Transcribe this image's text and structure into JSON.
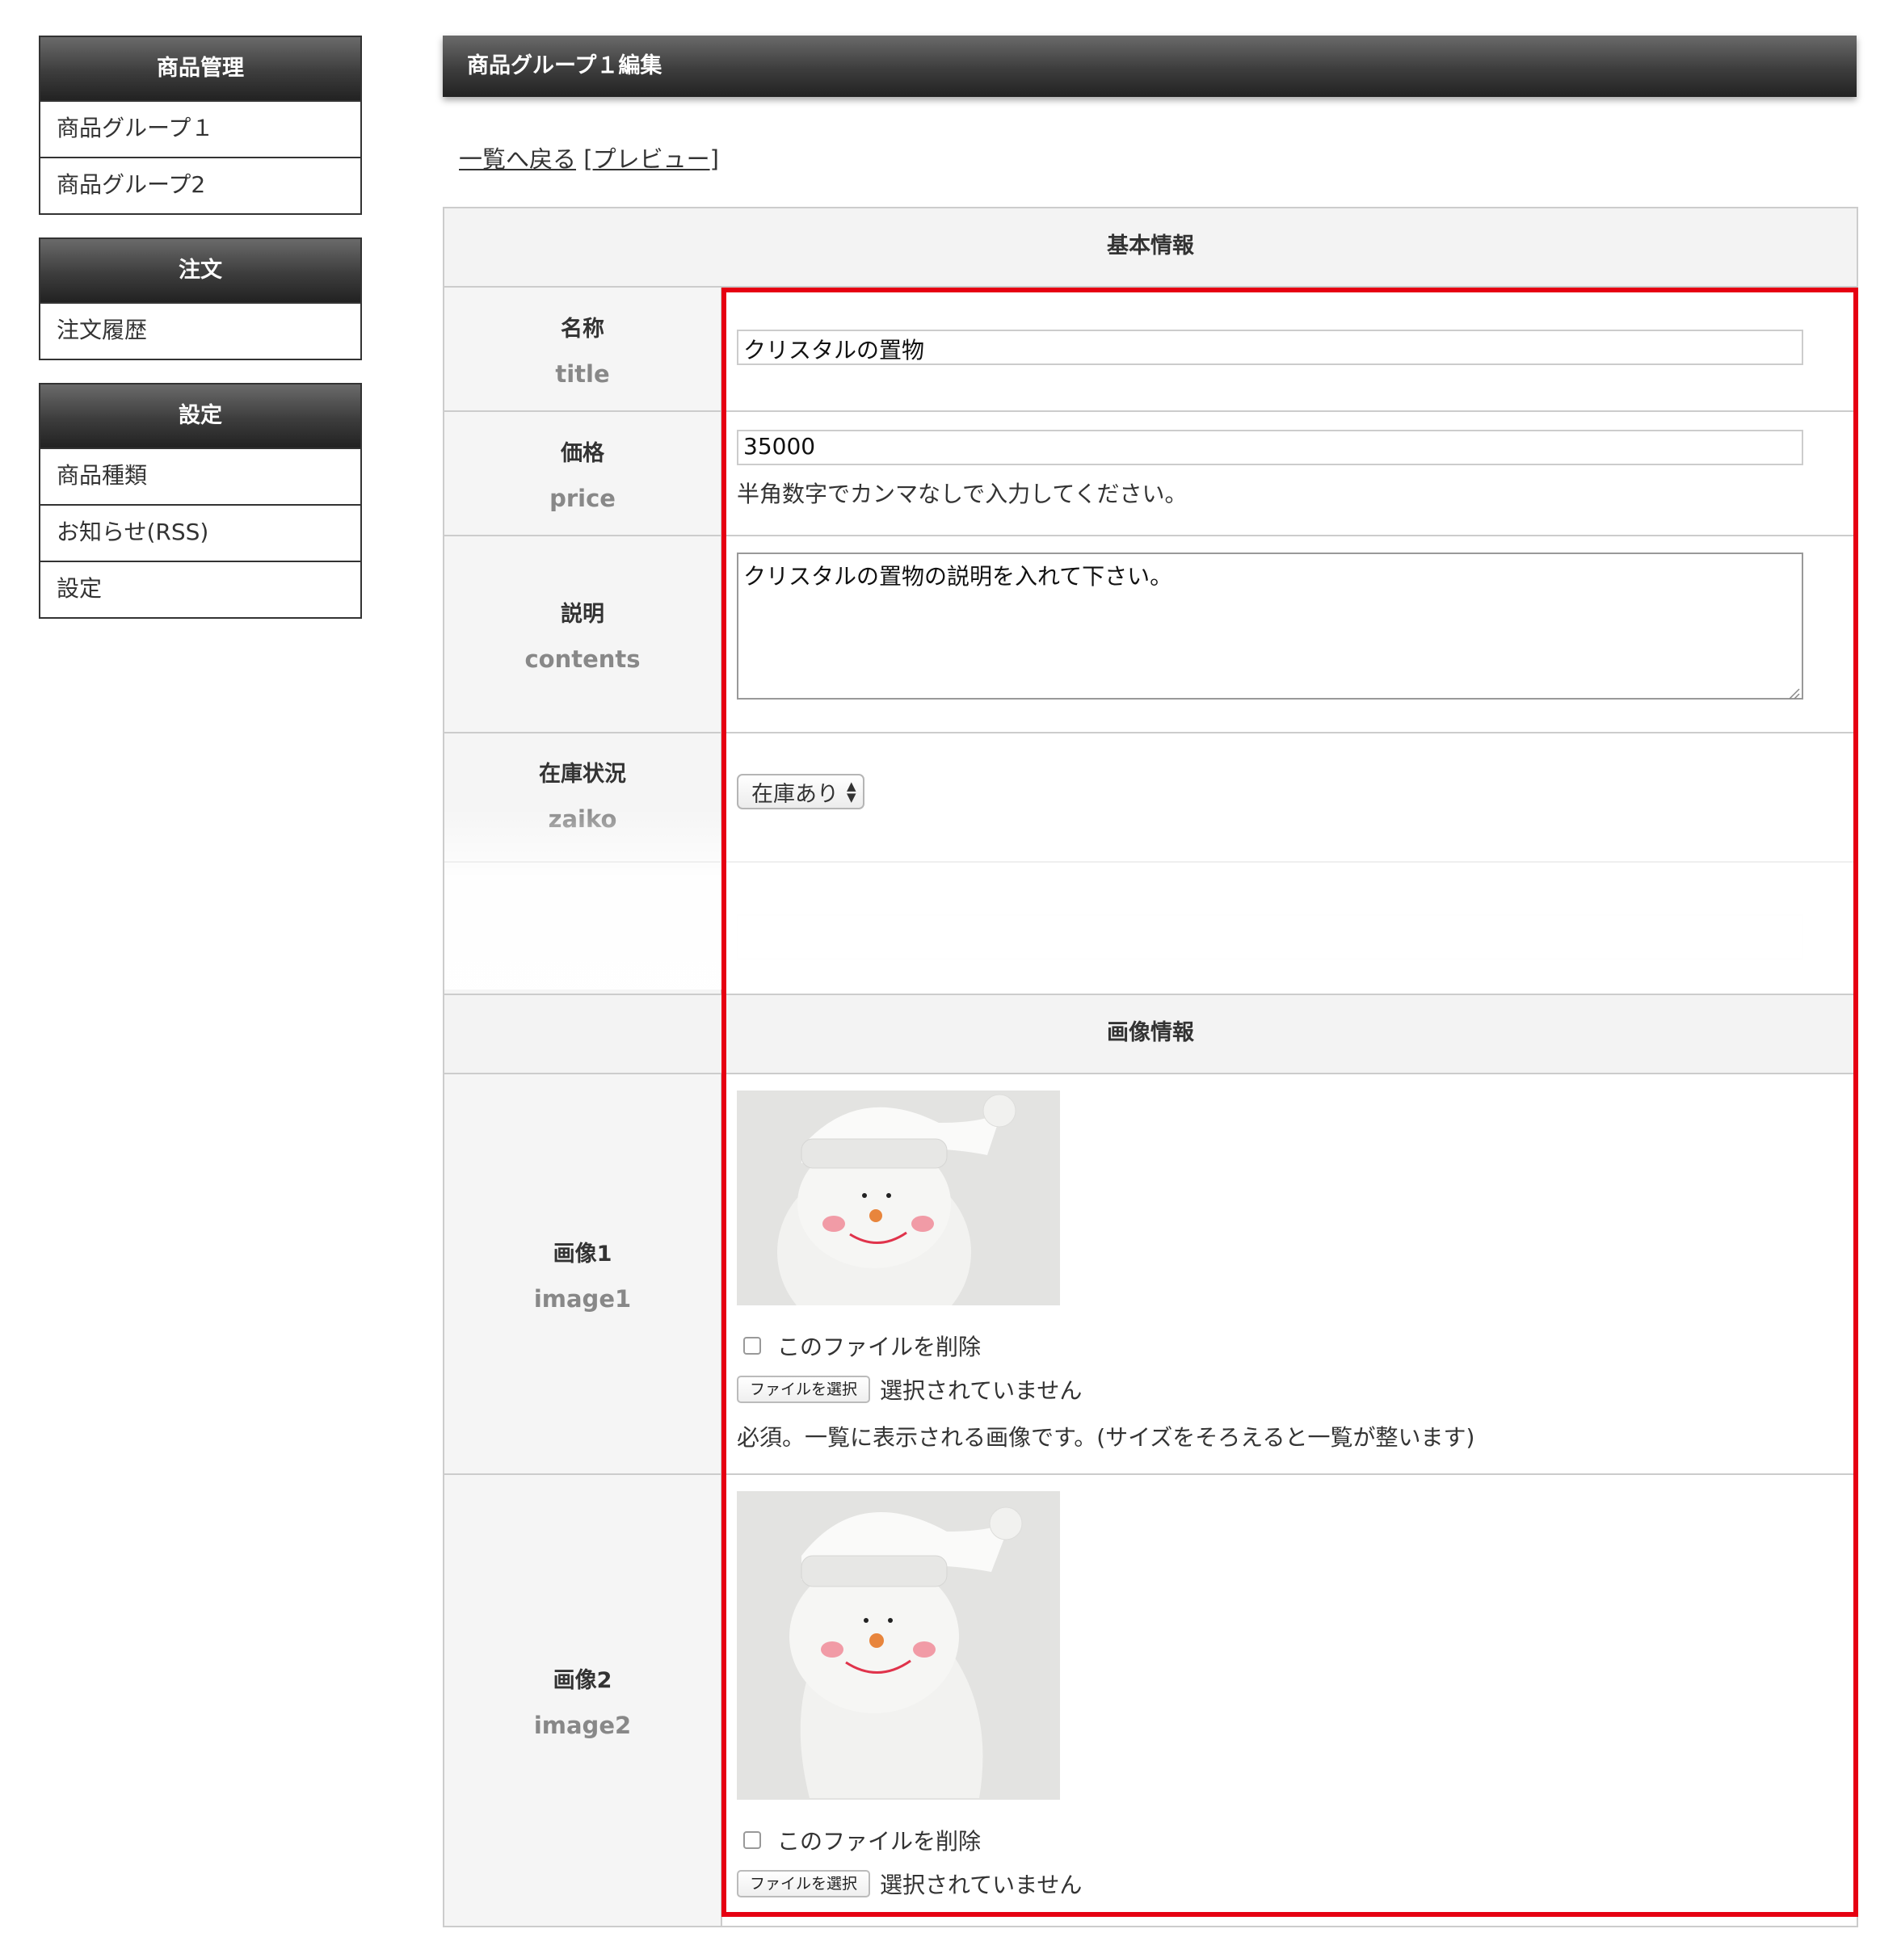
{
  "sidebar": {
    "sections": [
      {
        "title": "商品管理",
        "items": [
          "商品グループ１",
          "商品グループ2"
        ]
      },
      {
        "title": "注文",
        "items": [
          "注文履歴"
        ]
      },
      {
        "title": "設定",
        "items": [
          "商品種類",
          "お知らせ(RSS)",
          "設定"
        ]
      }
    ]
  },
  "header": {
    "title": "商品グループ１編集"
  },
  "links": {
    "back": "一覧へ戻る",
    "preview_open": "[",
    "preview": "プレビュー",
    "preview_close": "]"
  },
  "form": {
    "section_basic": "基本情報",
    "section_image": "画像情報",
    "fields": {
      "title": {
        "label": "名称",
        "key": "title",
        "value": "クリスタルの置物"
      },
      "price": {
        "label": "価格",
        "key": "price",
        "value": "35000",
        "note": "半角数字でカンマなしで入力してください。"
      },
      "contents": {
        "label": "説明",
        "key": "contents",
        "value": "クリスタルの置物の説明を入れて下さい。"
      },
      "zaiko": {
        "label": "在庫状況",
        "key": "zaiko",
        "selected": "在庫あり"
      },
      "image1": {
        "label": "画像1",
        "key": "image1",
        "delete_label": "このファイルを削除",
        "file_button": "ファイルを選択",
        "file_status": "選択されていません",
        "note": "必須。一覧に表示される画像です。(サイズをそろえると一覧が整います)"
      },
      "image2": {
        "label": "画像2",
        "key": "image2",
        "delete_label": "このファイルを削除",
        "file_button": "ファイルを選択",
        "file_status": "選択されていません"
      }
    }
  },
  "colors": {
    "highlight": "#e60012",
    "header_dark": "#2b2b2b",
    "label_bg": "#f5f5f5"
  },
  "icons": {
    "select_arrows": "updown-arrows-icon",
    "checkbox": "checkbox-icon",
    "resize": "resize-handle-icon"
  }
}
